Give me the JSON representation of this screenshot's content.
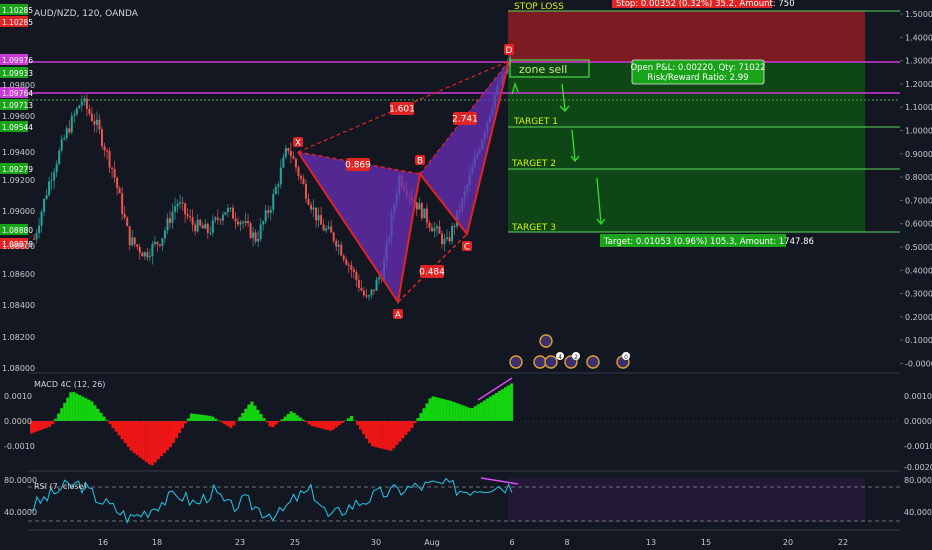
{
  "symbol_title": "AUD/NZD, 120, OANDA",
  "price_tags": [
    "1.10285",
    "1.10285",
    "1.09976",
    "1.09933",
    "1.09764",
    "1.09713",
    "1.09544",
    "1.09279",
    "1.08880",
    "1.08878"
  ],
  "left_axis_ticks": [
    "1.09800",
    "1.09600",
    "1.09400",
    "1.09200",
    "1.09000",
    "1.08800",
    "1.08600",
    "1.08400",
    "1.08200",
    "1.08000"
  ],
  "right_axis_ticks": [
    "1.5000",
    "1.4000",
    "1.3000",
    "1.2000",
    "1.1000",
    "1.0000",
    "0.9000",
    "0.8000",
    "0.7000",
    "0.6000",
    "0.5000",
    "0.4000",
    "0.3000",
    "0.2000",
    "0.1000",
    "-0.0000"
  ],
  "x_axis_ticks": [
    "16",
    "18",
    "23",
    "25",
    "30",
    "Aug",
    "6",
    "8",
    "13",
    "15",
    "20",
    "22"
  ],
  "stop_loss": {
    "label": "STOP LOSS",
    "info": "Stop: 0.00352 (0.32%) 35.2, Amount: 750"
  },
  "position_box": {
    "line1": "Open P&L: 0.00220, Qty: 71022",
    "line2": "Risk/Reward Ratio: 2.99"
  },
  "zone_label": "zone sell",
  "targets": [
    "TARGET 1",
    "TARGET 2",
    "TARGET 3"
  ],
  "target_info": "Target: 0.01053 (0.96%) 105.3, Amount: 1747.86",
  "pattern_points": [
    "X",
    "A",
    "B",
    "C",
    "D"
  ],
  "pattern_ratios": [
    "1.601",
    "0.869",
    "2.741",
    "0.484"
  ],
  "macd": {
    "title": "MACD 4C (12, 26)",
    "ticks": [
      "0.0010",
      "0.0000",
      "-0.0010",
      "-0.0020"
    ],
    "right_ticks": [
      "0.0010",
      "0.0000",
      "-0.0010"
    ]
  },
  "rsi": {
    "title": "RSI (7, close)",
    "ticks": [
      "80.0000",
      "40.0000"
    ]
  },
  "event_markers": [
    "4",
    "2",
    "0"
  ],
  "colors": {
    "background": "#131722",
    "up": "#26a69a",
    "down": "#ef5350",
    "pattern": "#e02424",
    "pattern_fill": "#6a2fb8",
    "stop_zone": "#8f1c22",
    "target_zone": "#0e4d14",
    "macd_up": "#13d40f",
    "macd_down": "#f01616",
    "rsi": "#22c8e8",
    "rsi_zone": "#241a38",
    "level_line": "#c93ad6"
  },
  "chart_data": {
    "type": "line",
    "title": "AUD/NZD, 120, OANDA",
    "x_ticks": [
      "16",
      "18",
      "23",
      "25",
      "30",
      "Aug",
      "6",
      "8",
      "13",
      "15",
      "20",
      "22"
    ],
    "price_levels": {
      "stop_loss": 1.10285,
      "zone_sell": 1.09933,
      "entry": 1.09713,
      "target_1": 1.09544,
      "target_2": 1.09279,
      "target_3": 1.0888
    },
    "harmonic_pattern": [
      {
        "point": "X",
        "price": 1.0942
      },
      {
        "point": "A",
        "price": 1.0838
      },
      {
        "point": "B",
        "price": 1.0922
      },
      {
        "point": "C",
        "price": 1.0876
      },
      {
        "point": "D",
        "price": 1.0999
      }
    ],
    "pattern_ratios": {
      "XA-B": 0.869,
      "AB-C": 0.484,
      "BC-D": 2.741,
      "XA-D": 1.601
    },
    "price_series_approx": [
      1.088,
      1.092,
      1.095,
      1.0973,
      1.0955,
      1.0925,
      1.088,
      1.087,
      1.088,
      1.0905,
      1.089,
      1.0885,
      1.09,
      1.0893,
      1.088,
      1.0905,
      1.0942,
      1.0915,
      1.089,
      1.088,
      1.086,
      1.0838,
      1.086,
      1.0922,
      1.0905,
      1.089,
      1.0876,
      1.0905,
      1.094,
      1.0975,
      1.0999
    ],
    "macd_approx": [
      -0.0005,
      -0.0002,
      0.0012,
      0.0008,
      -0.0002,
      -0.0012,
      -0.0018,
      -0.001,
      0.0003,
      0.0002,
      -0.0003,
      0.0008,
      -0.0003,
      0.0004,
      -0.0002,
      -0.0004,
      0.0002,
      -0.001,
      -0.0012,
      -0.0003,
      0.001,
      0.0008,
      0.0005,
      0.001,
      0.0015
    ],
    "rsi_approx": [
      45,
      60,
      75,
      80,
      60,
      45,
      30,
      40,
      55,
      65,
      50,
      70,
      45,
      55,
      40,
      35,
      60,
      70,
      30,
      45,
      55,
      65,
      70,
      75,
      78,
      80,
      70,
      75,
      78,
      76
    ]
  }
}
